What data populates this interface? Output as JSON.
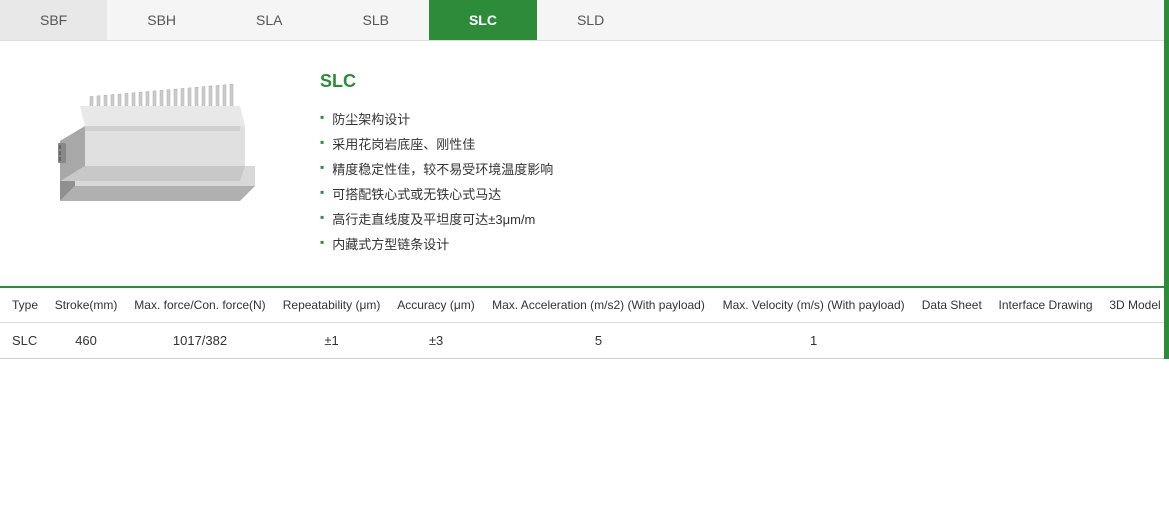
{
  "tabs": [
    {
      "id": "sbf",
      "label": "SBF",
      "active": false
    },
    {
      "id": "sbh",
      "label": "SBH",
      "active": false
    },
    {
      "id": "sla",
      "label": "SLA",
      "active": false
    },
    {
      "id": "slb",
      "label": "SLB",
      "active": false
    },
    {
      "id": "slc",
      "label": "SLC",
      "active": true
    },
    {
      "id": "sld",
      "label": "SLD",
      "active": false
    }
  ],
  "product": {
    "title": "SLC",
    "features": [
      "防尘架构设计",
      "采用花岗岩底座、刚性佳",
      "精度稳定性佳，较不易受环境温度影响",
      "可搭配铁心式或无铁心式马达",
      "高行走直线度及平坦度可达±3μm/m",
      "内藏式方型链条设计"
    ]
  },
  "table": {
    "headers": [
      {
        "id": "type",
        "label": "Type",
        "align": "left"
      },
      {
        "id": "stroke",
        "label": "Stroke(mm)",
        "align": "center"
      },
      {
        "id": "max_force",
        "label": "Max. force/Con. force(N)",
        "align": "center"
      },
      {
        "id": "repeatability",
        "label": "Repeatability (μm)",
        "align": "center"
      },
      {
        "id": "accuracy",
        "label": "Accuracy (μm)",
        "align": "center"
      },
      {
        "id": "max_accel",
        "label": "Max. Acceleration (m/s2) (With payload)",
        "align": "center"
      },
      {
        "id": "max_velocity",
        "label": "Max. Velocity (m/s) (With payload)",
        "align": "center"
      },
      {
        "id": "data_sheet",
        "label": "Data Sheet",
        "align": "center"
      },
      {
        "id": "interface_drawing",
        "label": "Interface Drawing",
        "align": "center"
      },
      {
        "id": "3d_model",
        "label": "3D Model",
        "align": "center"
      }
    ],
    "rows": [
      {
        "type": "SLC",
        "stroke": "460",
        "max_force": "1017/382",
        "repeatability": "±1",
        "accuracy": "±3",
        "max_accel": "5",
        "max_velocity": "1",
        "data_sheet": "",
        "interface_drawing": "",
        "3d_model": ""
      }
    ]
  },
  "colors": {
    "accent": "#2e8b3a",
    "tab_active_bg": "#2e8b3a",
    "tab_active_text": "#ffffff"
  }
}
